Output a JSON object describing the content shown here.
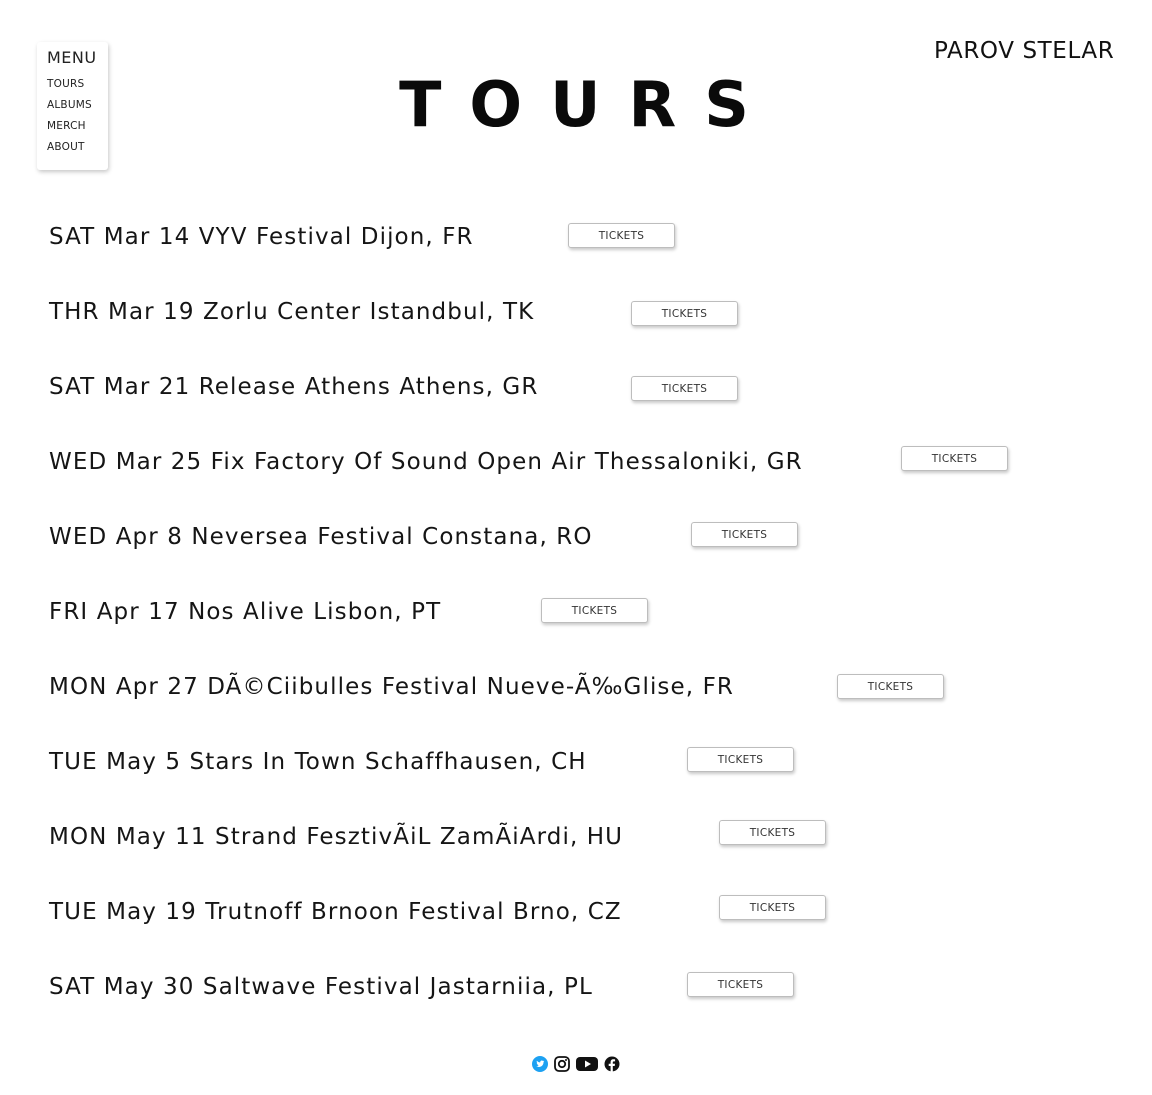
{
  "menu": {
    "title": "MENU",
    "items": [
      {
        "label": "TOURS"
      },
      {
        "label": "ALBUMS"
      },
      {
        "label": "MERCH"
      },
      {
        "label": "ABOUT"
      }
    ]
  },
  "logo": {
    "text": "PAROV STELAR"
  },
  "page_title": "TOURS",
  "tours": [
    {
      "text": "SAT Mar 14 VYV Festival Dijon, FR",
      "button": "TICKETS"
    },
    {
      "text": "THR Mar 19 Zorlu Center Istandbul, TK",
      "button": "TICKETS"
    },
    {
      "text": "SAT Mar 21 Release Athens Athens, GR",
      "button": "TICKETS"
    },
    {
      "text": "WED Mar 25 Fix Factory Of Sound Open Air Thessaloniki, GR",
      "button": "TICKETS"
    },
    {
      "text": "WED Apr 8 Neversea Festival Constana, RO",
      "button": "TICKETS"
    },
    {
      "text": "FRI Apr 17 Nos Alive Lisbon, PT",
      "button": "TICKETS"
    },
    {
      "text": "MON Apr 27 DÃ©Ciibulles Festival Nueve-Ã‰Glise, FR",
      "button": "TICKETS"
    },
    {
      "text": "TUE May 5 Stars In Town Schaffhausen, CH",
      "button": "TICKETS"
    },
    {
      "text": "MON May 11 Strand FesztivÃiL ZamÃiArdi, HU",
      "button": "TICKETS"
    },
    {
      "text": "TUE May 19 Trutnoff Brnoon Festival Brno, CZ",
      "button": "TICKETS"
    },
    {
      "text": "SAT May 30 Saltwave Festival Jastarniia, PL",
      "button": "TICKETS"
    }
  ],
  "social": [
    {
      "icon": "twitter-icon",
      "color": "#1da1f2"
    },
    {
      "icon": "instagram-icon",
      "color": "#111111"
    },
    {
      "icon": "youtube-icon",
      "color": "#111111"
    },
    {
      "icon": "facebook-icon",
      "color": "#111111"
    }
  ]
}
